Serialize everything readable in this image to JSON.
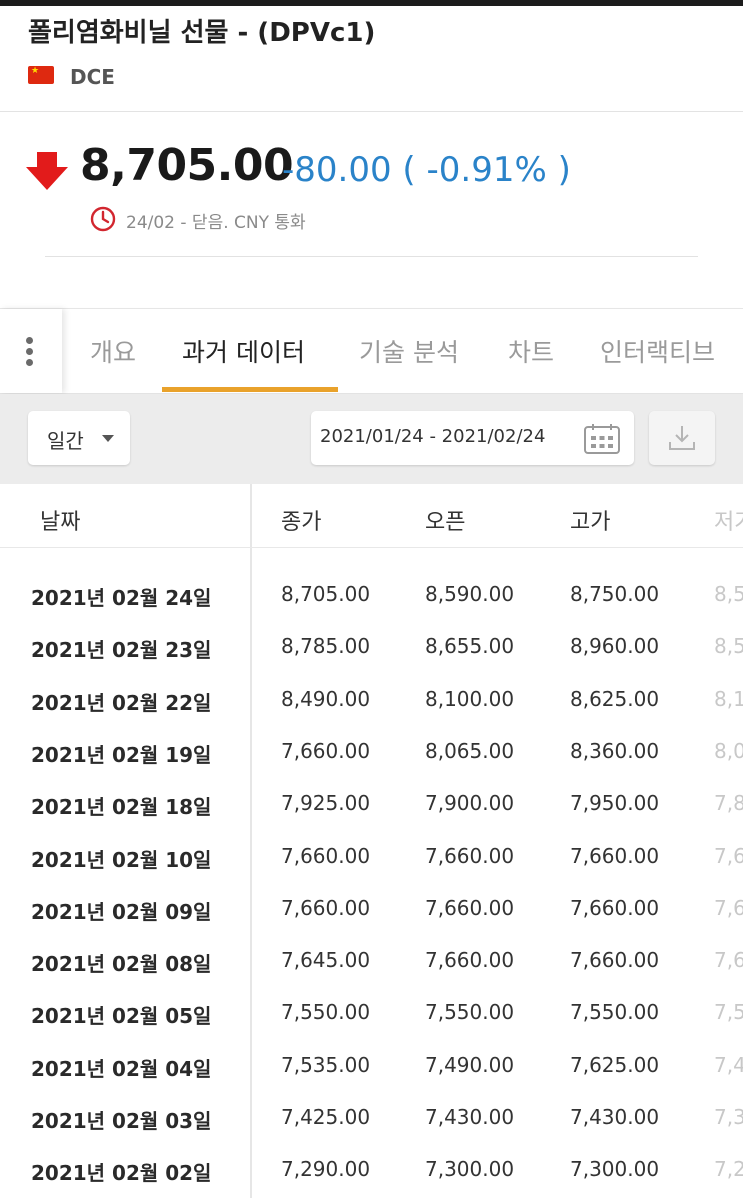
{
  "header": {
    "title": "폴리염화비닐 선물 - (DPVc1)",
    "exchange": "DCE",
    "flag_icon": "china-flag-icon"
  },
  "quote": {
    "price": "8,705.00",
    "change": "-80.00 ( -0.91% )",
    "status": "24/02 - 닫음. CNY 통화",
    "direction_icon": "arrow-down-icon",
    "down_color": "#e21b1b"
  },
  "tabs": [
    {
      "label": "개요",
      "active": false
    },
    {
      "label": "과거 데이터",
      "active": true
    },
    {
      "label": "기술 분석",
      "active": false
    },
    {
      "label": "차트",
      "active": false
    },
    {
      "label": "인터랙티브",
      "active": false
    }
  ],
  "toolbar": {
    "period": "일간",
    "date_range": "2021/01/24 - 2021/02/24",
    "calendar_icon": "calendar-icon",
    "download_icon": "download-icon"
  },
  "table": {
    "columns": [
      "날짜",
      "종가",
      "오픈",
      "고가",
      "저가"
    ],
    "rows": [
      {
        "date": "2021년 02월 24일",
        "close": "8,705.00",
        "close_dir": "down",
        "open": "8,590.00",
        "high": "8,750.00",
        "low": "8,5"
      },
      {
        "date": "2021년 02월 23일",
        "close": "8,785.00",
        "close_dir": "up",
        "open": "8,655.00",
        "high": "8,960.00",
        "low": "8,5"
      },
      {
        "date": "2021년 02월 22일",
        "close": "8,490.00",
        "close_dir": "up",
        "open": "8,100.00",
        "high": "8,625.00",
        "low": "8,1"
      },
      {
        "date": "2021년 02월 19일",
        "close": "7,660.00",
        "close_dir": "down",
        "open": "8,065.00",
        "high": "8,360.00",
        "low": "8,0"
      },
      {
        "date": "2021년 02월 18일",
        "close": "7,925.00",
        "close_dir": "up",
        "open": "7,900.00",
        "high": "7,950.00",
        "low": "7,8"
      },
      {
        "date": "2021년 02월 10일",
        "close": "7,660.00",
        "close_dir": "down",
        "open": "7,660.00",
        "high": "7,660.00",
        "low": "7,6"
      },
      {
        "date": "2021년 02월 09일",
        "close": "7,660.00",
        "close_dir": "up",
        "open": "7,660.00",
        "high": "7,660.00",
        "low": "7,6"
      },
      {
        "date": "2021년 02월 08일",
        "close": "7,645.00",
        "close_dir": "up",
        "open": "7,660.00",
        "high": "7,660.00",
        "low": "7,6"
      },
      {
        "date": "2021년 02월 05일",
        "close": "7,550.00",
        "close_dir": "up",
        "open": "7,550.00",
        "high": "7,550.00",
        "low": "7,5"
      },
      {
        "date": "2021년 02월 04일",
        "close": "7,535.00",
        "close_dir": "up",
        "open": "7,490.00",
        "high": "7,625.00",
        "low": "7,4"
      },
      {
        "date": "2021년 02월 03일",
        "close": "7,425.00",
        "close_dir": "up",
        "open": "7,430.00",
        "high": "7,430.00",
        "low": "7,3"
      },
      {
        "date": "2021년 02월 02일",
        "close": "7,290.00",
        "close_dir": "down",
        "open": "7,300.00",
        "high": "7,300.00",
        "low": "7,2"
      }
    ]
  },
  "colors": {
    "up": "#d2262f",
    "down": "#2a83c9",
    "tab_accent": "#e9a22b",
    "clock": "#d2262f"
  }
}
